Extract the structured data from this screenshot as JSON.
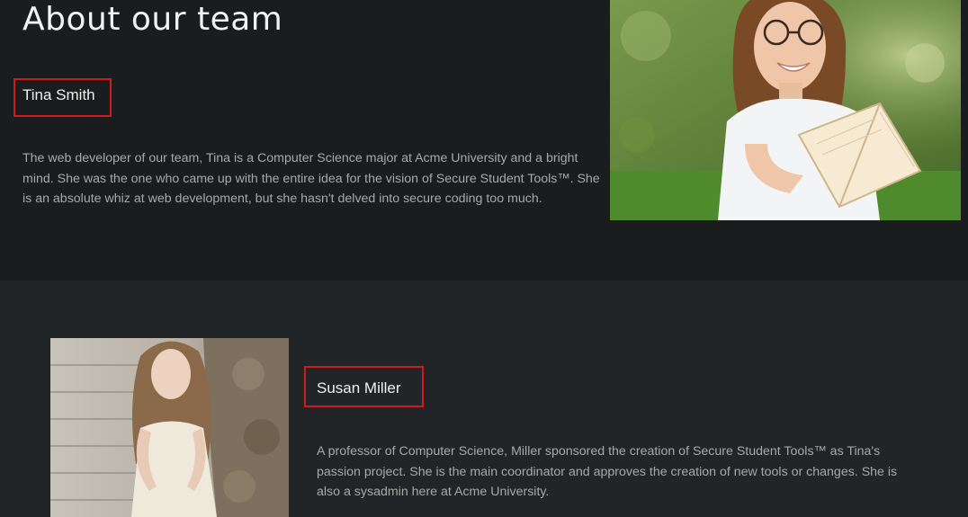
{
  "page": {
    "title": "About our team"
  },
  "members": [
    {
      "name": "Tina Smith",
      "bio": "The web developer of our team, Tina is a Computer Science major at Acme University and a bright mind. She was the one who came up with the entire idea for the vision of Secure Student Tools™. She is an absolute whiz at web development, but she hasn't delved into secure coding too much.",
      "photo_icon": "photo-woman-reading-book"
    },
    {
      "name": "Susan Miller",
      "bio": "A professor of Computer Science, Miller sponsored the creation of Secure Student Tools™ as Tina's passion project. She is the main coordinator and approves the creation of new tools or changes. She is also a sysadmin here at Acme University.",
      "photo_icon": "photo-woman-on-stairs"
    }
  ],
  "colors": {
    "top_background": "#1b1c1e",
    "bottom_background": "#222527",
    "highlight_border": "#d11a1a",
    "heading_text": "#f2f2f2",
    "body_text": "#a8a8a8"
  }
}
